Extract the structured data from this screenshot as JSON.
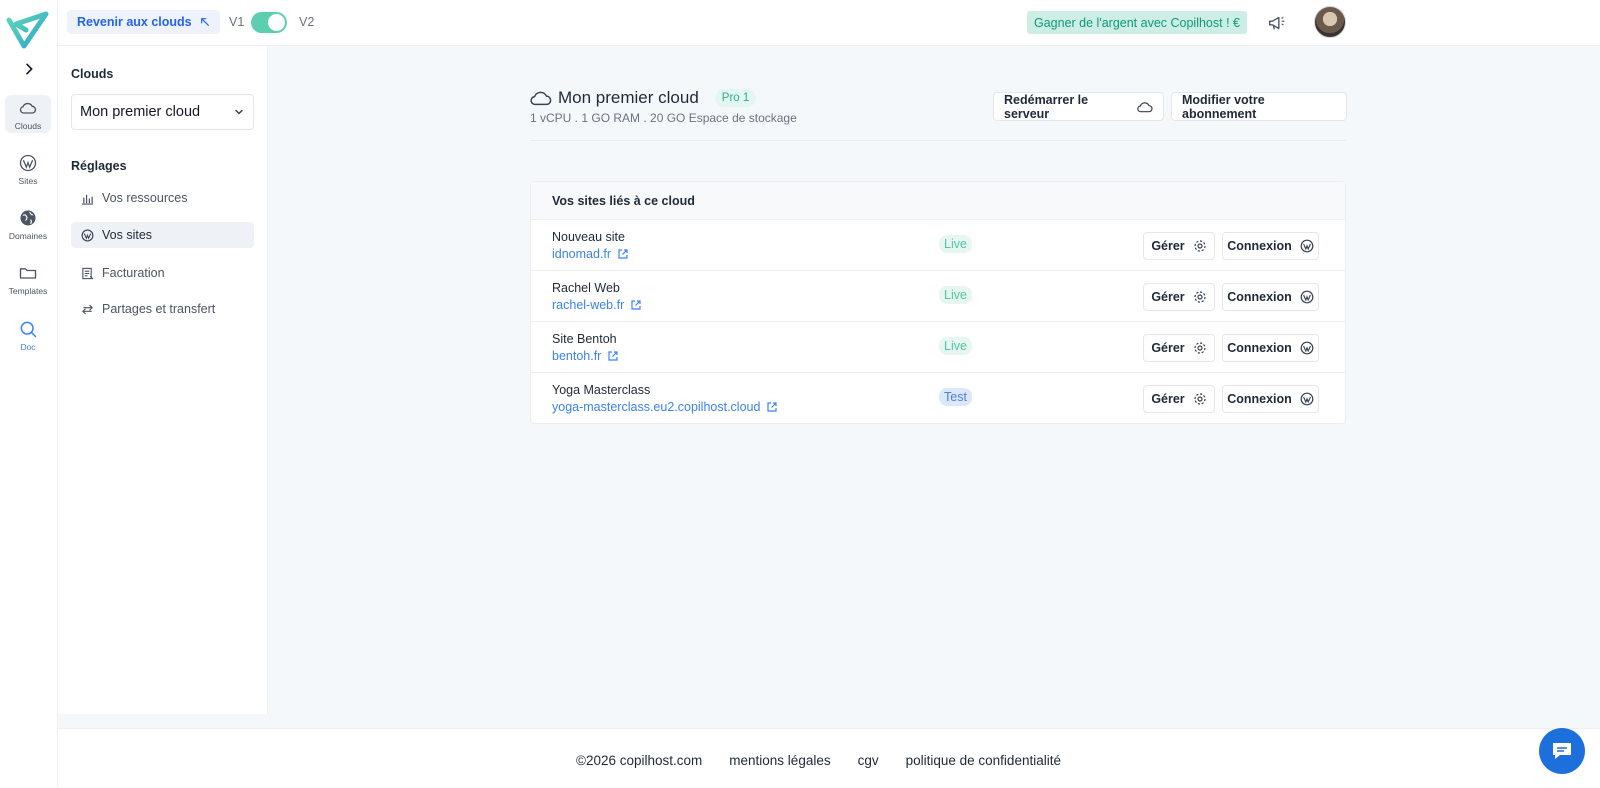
{
  "rail": {
    "items": [
      {
        "label": "Clouds",
        "icon": "cloud-icon"
      },
      {
        "label": "Sites",
        "icon": "wordpress-icon"
      },
      {
        "label": "Domaines",
        "icon": "globe-icon"
      },
      {
        "label": "Templates",
        "icon": "folder-icon"
      },
      {
        "label": "Doc",
        "icon": "search-icon"
      }
    ]
  },
  "topbar": {
    "back_label": "Revenir aux clouds",
    "v1": "V1",
    "v2": "V2",
    "earn_label": "Gagner de l'argent avec Copilhost ! €"
  },
  "sidebar": {
    "clouds_heading": "Clouds",
    "selected_cloud": "Mon premier cloud",
    "settings_heading": "Réglages",
    "items": [
      {
        "label": "Vos ressources",
        "icon": "chart-bar-icon"
      },
      {
        "label": "Vos sites",
        "icon": "wordpress-icon"
      },
      {
        "label": "Facturation",
        "icon": "invoice-icon"
      },
      {
        "label": "Partages et transfert",
        "icon": "transfer-icon"
      }
    ]
  },
  "main": {
    "cloud_name": "Mon premier cloud",
    "plan_badge": "Pro 1",
    "specs": "1 vCPU . 1 GO RAM . 20 GO Espace de stockage",
    "restart_label": "Redémarrer le serveur",
    "modify_label": "Modifier votre abonnement",
    "card_title": "Vos sites liés à ce cloud",
    "manage_label": "Gérer",
    "connect_label": "Connexion",
    "sites": [
      {
        "name": "Nouveau site",
        "url": "idnomad.fr",
        "status": "Live"
      },
      {
        "name": "Rachel Web",
        "url": "rachel-web.fr",
        "status": "Live"
      },
      {
        "name": "Site Bentoh",
        "url": "bentoh.fr",
        "status": "Live"
      },
      {
        "name": "Yoga Masterclass",
        "url": "yoga-masterclass.eu2.copilhost.cloud",
        "status": "Test"
      }
    ]
  },
  "footer": {
    "copyright": "©2026 copilhost.com",
    "legal": "mentions légales",
    "cgv": "cgv",
    "privacy": "politique de confidentialité"
  },
  "colors": {
    "accent_green": "#5ccfb1",
    "link_blue": "#3b82f6",
    "chat_blue": "#1d6fdc"
  }
}
